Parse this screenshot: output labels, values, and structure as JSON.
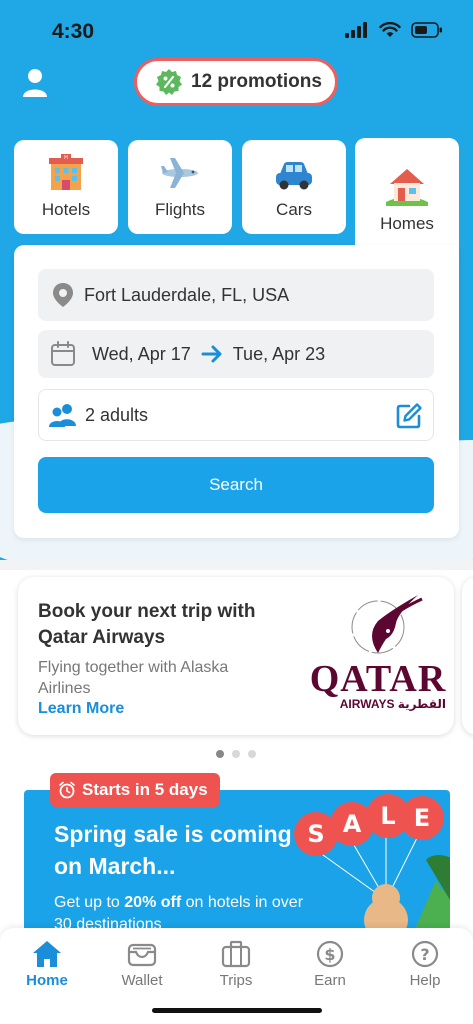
{
  "status_bar": {
    "time": "4:30"
  },
  "header": {
    "promotions_label": "12 promotions"
  },
  "tabs": [
    {
      "label": "Hotels",
      "icon": "hotel-icon"
    },
    {
      "label": "Flights",
      "icon": "airplane-icon"
    },
    {
      "label": "Cars",
      "icon": "car-icon"
    },
    {
      "label": "Homes",
      "icon": "house-icon",
      "active": true
    }
  ],
  "search": {
    "location": "Fort Lauderdale, FL, USA",
    "check_in": "Wed, Apr 17",
    "check_out": "Tue, Apr 23",
    "guests": "2 adults",
    "button_label": "Search"
  },
  "ad": {
    "title": "Book your next trip with Qatar Airways",
    "subtitle": "Flying together with Alaska Airlines",
    "link": "Learn More",
    "logo_text": "QATAR",
    "logo_subtext": "AIRWAYS القطرية",
    "carousel_page": 1,
    "carousel_total": 3
  },
  "banner": {
    "badge": "Starts in 5 days",
    "title": "Spring sale is coming on March...",
    "subtitle_prefix": "Get up to ",
    "subtitle_highlight": "20% off",
    "subtitle_suffix": " on hotels in over 30 destinations",
    "sale_word": "SALE"
  },
  "bottom_nav": [
    {
      "label": "Home",
      "icon": "home-icon",
      "active": true
    },
    {
      "label": "Wallet",
      "icon": "wallet-icon"
    },
    {
      "label": "Trips",
      "icon": "suitcase-icon"
    },
    {
      "label": "Earn",
      "icon": "dollar-coin-icon"
    },
    {
      "label": "Help",
      "icon": "help-icon"
    }
  ],
  "colors": {
    "brand_blue": "#20a7e6",
    "button_blue": "#1aa3e8",
    "promo_red": "#f05d5d",
    "qatar_maroon": "#5c0632"
  }
}
